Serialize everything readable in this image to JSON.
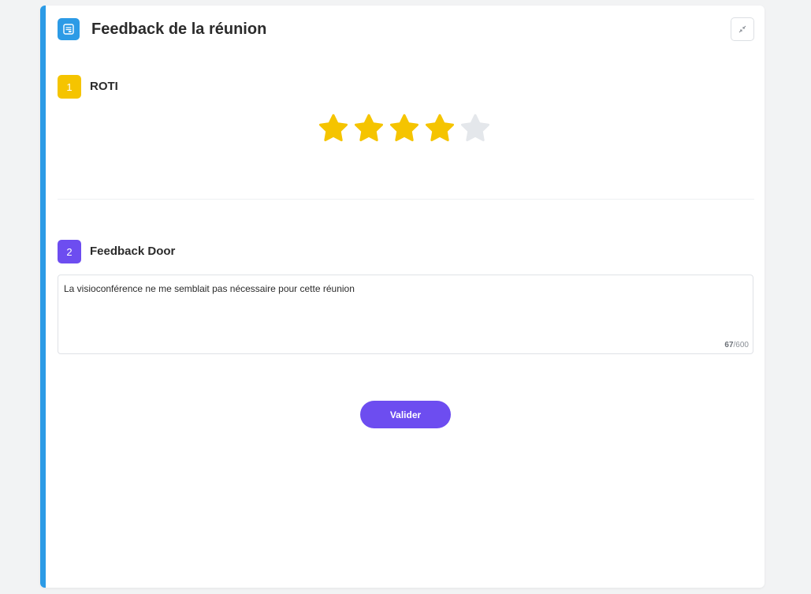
{
  "header": {
    "title": "Feedback de la réunion",
    "icon": "form-icon",
    "collapse_icon": "collapse-icon"
  },
  "sections": [
    {
      "number": "1",
      "label": "ROTI",
      "badge_color": "#f5c400",
      "rating": {
        "value": 4,
        "max": 5,
        "filled_color": "#f5c400",
        "empty_color": "#e4e7eb"
      }
    },
    {
      "number": "2",
      "label": "Feedback Door",
      "badge_color": "#6d4df0",
      "textarea": {
        "value": "La visioconférence ne me semblait pas nécessaire pour cette réunion",
        "count": "67",
        "limit": "/600"
      }
    }
  ],
  "submit_label": "Valider",
  "colors": {
    "accent": "#2c9be6",
    "primary": "#6d4df0"
  }
}
